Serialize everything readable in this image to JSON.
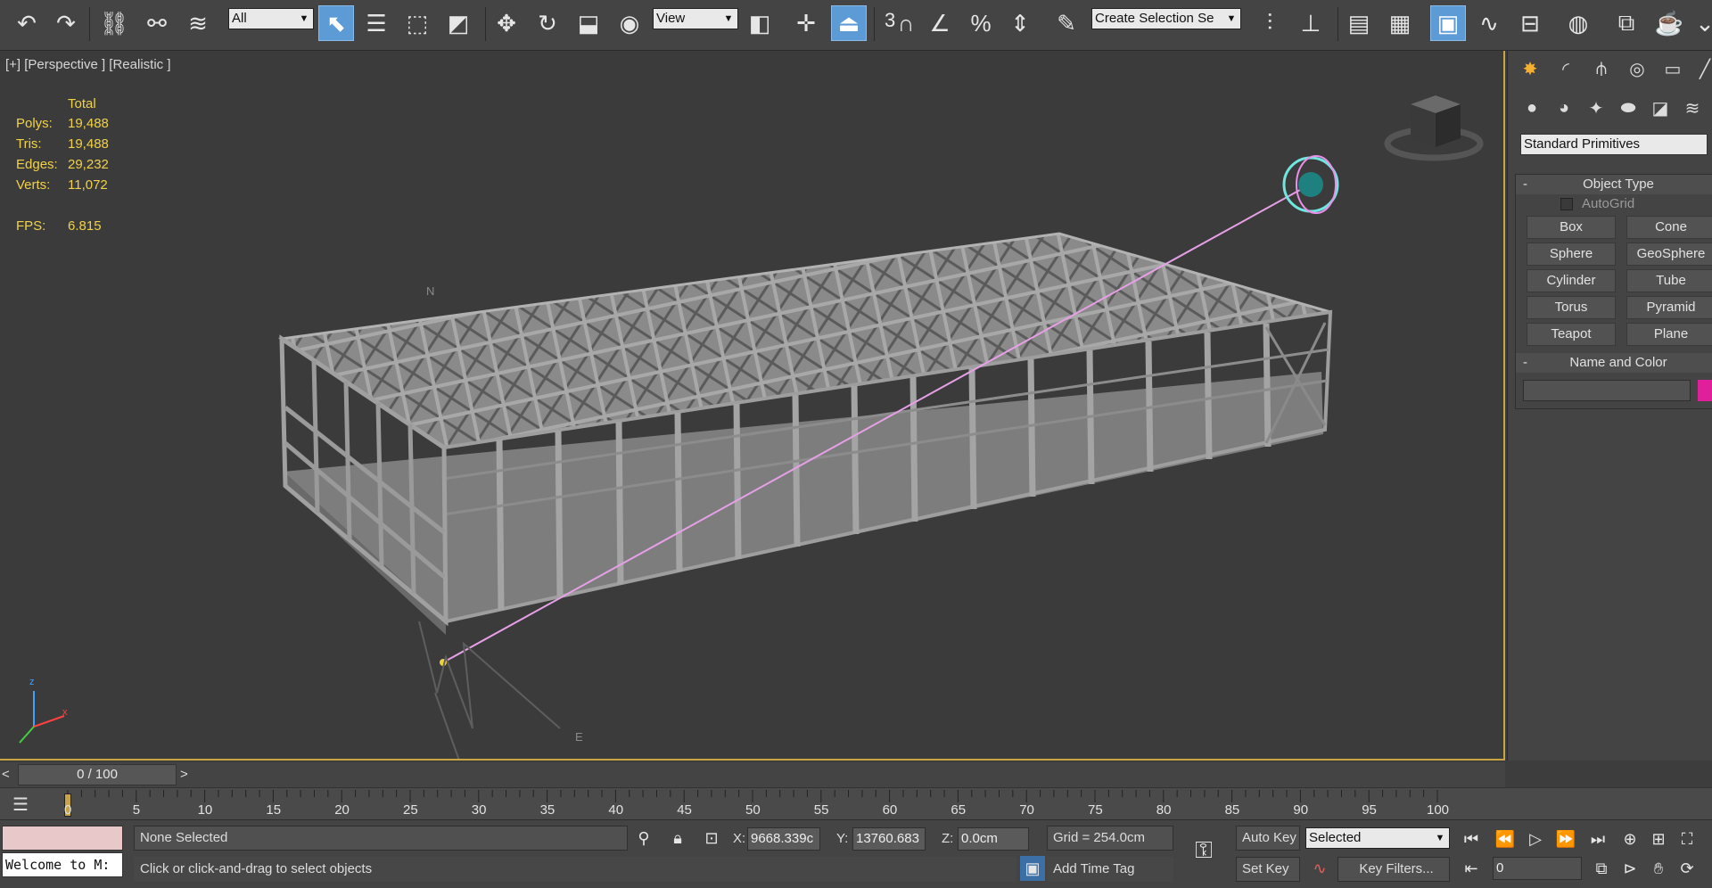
{
  "toolbar": {
    "selection_filter": "All",
    "reference_coord": "View",
    "snap_label": "3",
    "named_selection": "Create Selection Se"
  },
  "viewport": {
    "label": "[+] [Perspective ] [Realistic ]",
    "stats": {
      "total_label": "Total",
      "polys_label": "Polys:",
      "polys": "19,488",
      "tris_label": "Tris:",
      "tris": "19,488",
      "edges_label": "Edges:",
      "edges": "29,232",
      "verts_label": "Verts:",
      "verts": "11,072",
      "fps_label": "FPS:",
      "fps": "6.815"
    },
    "compass_n": "N",
    "compass_e": "E",
    "axis_z": "z",
    "axis_x": "x",
    "colors": {
      "accent_border": "#c8a442",
      "stats_text": "#f1d249",
      "light_line": "#e6a0e6"
    }
  },
  "command_panel": {
    "category": "Standard Primitives",
    "object_type_title": "Object Type",
    "autogrid": "AutoGrid",
    "primitives": [
      "Box",
      "Cone",
      "Sphere",
      "GeoSphere",
      "Cylinder",
      "Tube",
      "Torus",
      "Pyramid",
      "Teapot",
      "Plane"
    ],
    "name_color_title": "Name and Color",
    "minus": "-",
    "swatch_color": "#e0209a"
  },
  "timeline": {
    "frame": "0 / 100",
    "prev": "<",
    "next": ">",
    "ticks": [
      "0",
      "5",
      "10",
      "15",
      "20",
      "25",
      "30",
      "35",
      "40",
      "45",
      "50",
      "55",
      "60",
      "65",
      "70",
      "75",
      "80",
      "85",
      "90",
      "95",
      "100"
    ],
    "range_end": 100
  },
  "status": {
    "maxscript_line": "Welcome to M:",
    "selection": "None Selected",
    "prompt": "Click or click-and-drag to select objects",
    "x_label": "X:",
    "x": "9668.339c",
    "y_label": "Y:",
    "y": "13760.683",
    "z_label": "Z:",
    "z": "0.0cm",
    "grid": "Grid = 254.0cm",
    "add_time_tag": "Add Time Tag",
    "auto_key": "Auto Key",
    "set_key": "Set Key",
    "key_mode": "Selected",
    "key_filters": "Key Filters...",
    "frame_value": "0"
  }
}
